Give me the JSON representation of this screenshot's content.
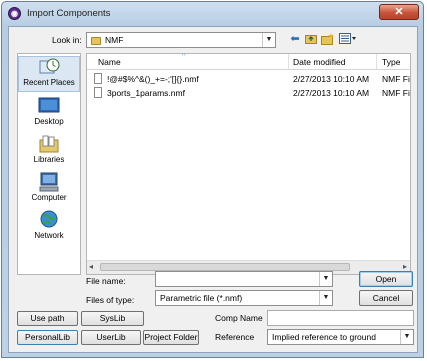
{
  "window": {
    "title": "Import Components",
    "close_glyph": "✕"
  },
  "toolbar": {
    "look_in_label": "Look in:",
    "look_in_value": "NMF",
    "icons": [
      "back-arrow-icon",
      "up-folder-icon",
      "new-folder-icon",
      "view-menu-icon"
    ]
  },
  "places": [
    {
      "label": "Recent Places",
      "icon": "recent-places-icon"
    },
    {
      "label": "Desktop",
      "icon": "desktop-icon"
    },
    {
      "label": "Libraries",
      "icon": "libraries-icon"
    },
    {
      "label": "Computer",
      "icon": "computer-icon"
    },
    {
      "label": "Network",
      "icon": "network-icon"
    }
  ],
  "file_list": {
    "columns": [
      "Name",
      "Date modified",
      "Type"
    ],
    "rows": [
      {
        "name": "!@#$%^&()_+=-;'[]{}.nmf",
        "date": "2/27/2013 10:10 AM",
        "type": "NMF File"
      },
      {
        "name": "3ports_1params.nmf",
        "date": "2/27/2013 10:10 AM",
        "type": "NMF File"
      }
    ]
  },
  "form": {
    "file_name_label": "File name:",
    "file_name_value": "",
    "files_of_type_label": "Files of type:",
    "files_of_type_value": "Parametric file (*.nmf)",
    "open_label": "Open",
    "cancel_label": "Cancel"
  },
  "bottom": {
    "use_path_label": "Use path",
    "syslib_label": "SysLib",
    "personallib_label": "PersonalLib",
    "userlib_label": "UserLib",
    "project_folder_label": "Project Folder",
    "comp_name_label": "Comp Name",
    "comp_name_value": "",
    "reference_label": "Reference",
    "reference_value": "Implied reference to ground"
  },
  "colors": {
    "title_bg": "#bcd0e6",
    "close": "#c7543a",
    "selection": "#dce7f4"
  }
}
